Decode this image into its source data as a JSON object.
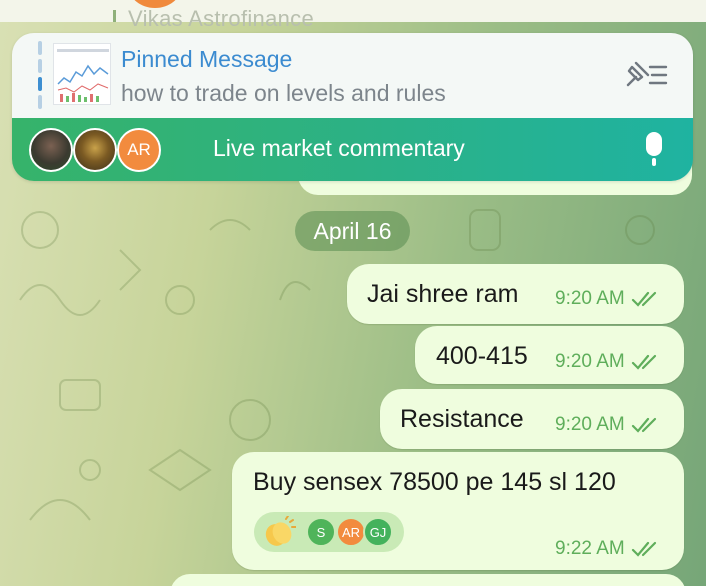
{
  "top_peek": {
    "text": "Vikas Astrofinance"
  },
  "pinned": {
    "title": "Pinned Message",
    "subtitle": "how to trade on levels and rules",
    "thumb_icon": "chart-thumbnail",
    "action_icon": "pinned-list-icon"
  },
  "live": {
    "label": "Live market commentary",
    "avatar_initials": "AR",
    "mic_icon": "microphone-icon"
  },
  "date_chip": "April 16",
  "messages": [
    {
      "text": "Jai shree ram",
      "time": "9:20 AM",
      "status": "read"
    },
    {
      "text": "400-415",
      "time": "9:20 AM",
      "status": "read"
    },
    {
      "text": "Resistance",
      "time": "9:20 AM",
      "status": "read"
    },
    {
      "text": "Buy sensex 78500 pe 145 sl 120",
      "time": "9:22 AM",
      "status": "read",
      "reaction": {
        "emoji": "clapping-hands-icon",
        "users": [
          "S",
          "AR",
          "GJ"
        ]
      }
    }
  ],
  "colors": {
    "bubble": "#effdde",
    "accent_blue": "#3b8bd0",
    "time_green": "#5fae5b",
    "live_bar_start": "#36b36a",
    "live_bar_end": "#1fb3a1"
  }
}
